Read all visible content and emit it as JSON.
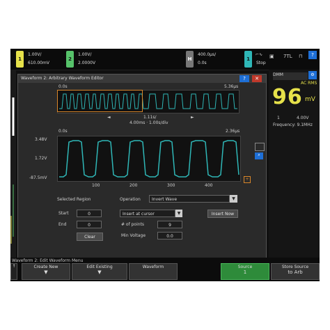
{
  "channels": [
    {
      "id": "1",
      "color": "#e6e14a",
      "line1": "1.00V/",
      "line2": "610.00mV"
    },
    {
      "id": "2",
      "color": "#56c26a",
      "line1": "1.00V/",
      "line2": "2.0000V"
    }
  ],
  "timebase": {
    "line1": "400.0µs/",
    "line2": "0.0s"
  },
  "trigger": {
    "line1": "1",
    "line2": "Stop",
    "extra": "7TL"
  },
  "right_panel": {
    "title": "DMM",
    "mode": "AC RMS",
    "reading": "96",
    "unit": "mV",
    "line1": "1",
    "line2": "4.00V",
    "freq": "Frequency: 9.1MHz"
  },
  "dialog": {
    "title": "Waveform 2: Arbitrary Waveform Editor",
    "ovw_left": "0.0s",
    "ovw_right": "5.36µs",
    "nav": {
      "left": "◄",
      "mid1": "1.11s/",
      "mid2": "4.00ms  ·  1.00s/div",
      "right": "►"
    },
    "zoom_left": "0.0s",
    "zoom_right": "2.36µs",
    "y_labels": [
      "3.48V",
      "1.72V",
      "-87.5mV"
    ],
    "x_labels": [
      "100",
      "200",
      "300",
      "400"
    ],
    "selected_region": "Selected Region",
    "start_label": "Start",
    "start_val": "0",
    "end_label": "End",
    "end_val": "0",
    "clear_label": "Clear",
    "operation_label": "Operation",
    "operation_val": "Invert Wave",
    "insert_label": "Insert at cursor",
    "points_label": "# of points",
    "points_val": "9",
    "minmax_label": "Min Voltage",
    "minmax_val": "0.0",
    "insert_btn": "Insert Now"
  },
  "status_text": "Waveform 2: Edit Waveform Menu",
  "softkeys": [
    {
      "a": "Create New",
      "b": "▼"
    },
    {
      "a": "Edit Existing",
      "b": "▼"
    },
    {
      "a": "Waveform",
      "b": ""
    },
    {
      "a": "Source",
      "b": "1"
    },
    {
      "a": "Store Source",
      "b": "to Arb"
    }
  ]
}
